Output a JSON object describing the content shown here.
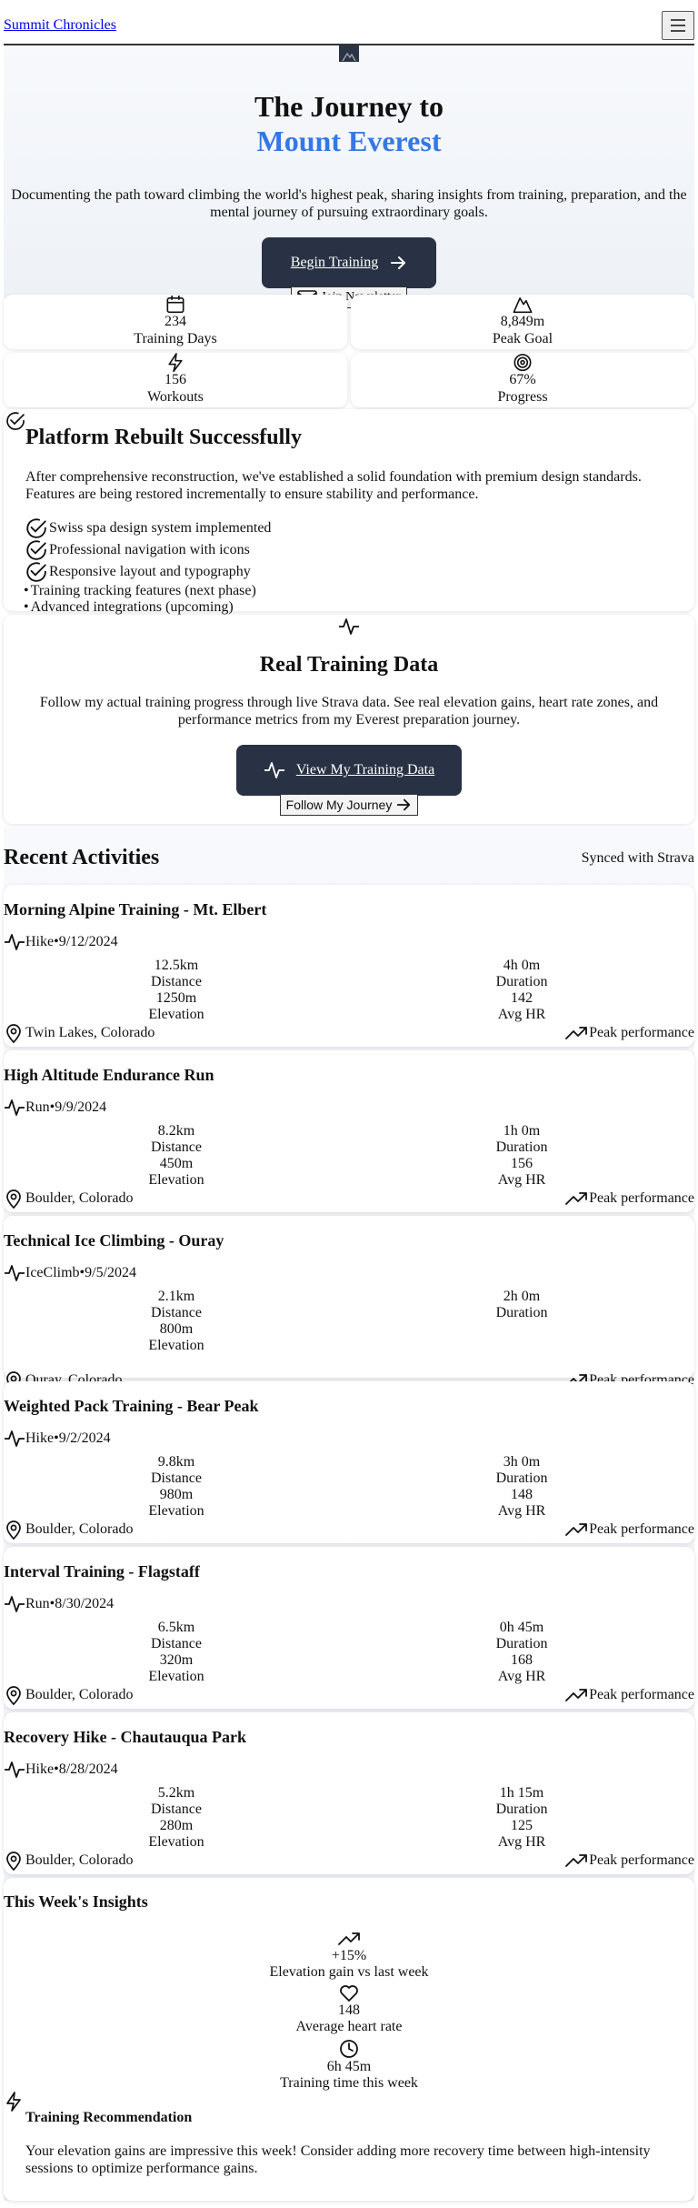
{
  "nav": {
    "brand": "Summit Chronicles"
  },
  "hero": {
    "title_line1": "The Journey to",
    "title_line2": "Mount Everest",
    "description": "Documenting the path toward climbing the world's highest peak, sharing insights from training, preparation, and the mental journey of pursuing extraordinary goals.",
    "primary_cta": "Begin Training",
    "secondary_cta": "Join Newsletter"
  },
  "stats": [
    {
      "icon": "calendar-icon",
      "value": "234",
      "label": "Training Days"
    },
    {
      "icon": "mountain-icon",
      "value": "8,849m",
      "label": "Peak Goal"
    },
    {
      "icon": "lightning-icon",
      "value": "156",
      "label": "Workouts"
    },
    {
      "icon": "target-icon",
      "value": "67%",
      "label": "Progress"
    }
  ],
  "rebuilt": {
    "title": "Platform Rebuilt Successfully",
    "description": "After comprehensive reconstruction, we've established a solid foundation with premium design standards. Features are being restored incrementally to ensure stability and performance.",
    "done": [
      "Swiss spa design system implemented",
      "Professional navigation with icons",
      "Responsive layout and typography"
    ],
    "pending_bullet": "•",
    "pending": [
      "Training tracking features (next phase)",
      "Advanced integrations (upcoming)"
    ]
  },
  "training": {
    "title": "Real Training Data",
    "description": "Follow my actual training progress through live Strava data. See real elevation gains, heart rate zones, and performance metrics from my Everest preparation journey.",
    "primary_cta": "View My Training Data",
    "secondary_cta": "Follow My Journey"
  },
  "recent": {
    "title": "Recent Activities",
    "sync": "Synced with Strava",
    "labels": {
      "distance": "Distance",
      "duration": "Duration",
      "elevation": "Elevation",
      "avg_hr": "Avg HR",
      "badge": "Peak performance",
      "sep": "•"
    },
    "activities": [
      {
        "title": "Morning Alpine Training - Mt. Elbert",
        "type": "Hike",
        "date": "9/12/2024",
        "distance": "12.5km",
        "duration": "4h 0m",
        "elevation": "1250m",
        "hr": "142",
        "location": "Twin Lakes, Colorado"
      },
      {
        "title": "High Altitude Endurance Run",
        "type": "Run",
        "date": "9/9/2024",
        "distance": "8.2km",
        "duration": "1h 0m",
        "elevation": "450m",
        "hr": "156",
        "location": "Boulder, Colorado"
      },
      {
        "title": "Technical Ice Climbing - Ouray",
        "type": "IceClimb",
        "date": "9/5/2024",
        "distance": "2.1km",
        "duration": "2h 0m",
        "elevation": "800m",
        "hr": "",
        "location": "Ouray, Colorado"
      },
      {
        "title": "Weighted Pack Training - Bear Peak",
        "type": "Hike",
        "date": "9/2/2024",
        "distance": "9.8km",
        "duration": "3h 0m",
        "elevation": "980m",
        "hr": "148",
        "location": "Boulder, Colorado"
      },
      {
        "title": "Interval Training - Flagstaff",
        "type": "Run",
        "date": "8/30/2024",
        "distance": "6.5km",
        "duration": "0h 45m",
        "elevation": "320m",
        "hr": "168",
        "location": "Boulder, Colorado"
      },
      {
        "title": "Recovery Hike - Chautauqua Park",
        "type": "Hike",
        "date": "8/28/2024",
        "distance": "5.2km",
        "duration": "1h 15m",
        "elevation": "280m",
        "hr": "125",
        "location": "Boulder, Colorado"
      }
    ]
  },
  "insights": {
    "title": "This Week's Insights",
    "items": [
      {
        "icon": "trending-up-icon",
        "value": "+15%",
        "label": "Elevation gain vs last week"
      },
      {
        "icon": "heart-icon",
        "value": "148",
        "label": "Average heart rate"
      },
      {
        "icon": "clock-icon",
        "value": "6h 45m",
        "label": "Training time this week"
      }
    ],
    "recommendation_title": "Training Recommendation",
    "recommendation_text": "Your elevation gains are impressive this week! Consider adding more recovery time between high-intensity sessions to optimize performance gains."
  }
}
